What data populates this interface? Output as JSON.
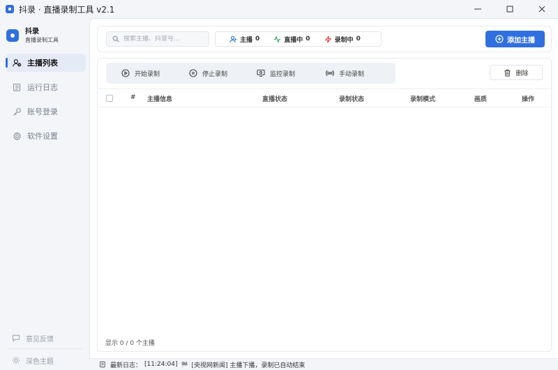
{
  "window": {
    "title": "抖录 · 直播录制工具 v2.1"
  },
  "brand": {
    "name": "抖录",
    "subtitle": "直播录制工具"
  },
  "sidebar": {
    "items": [
      {
        "label": "主播列表",
        "icon": "users-icon",
        "active": true
      },
      {
        "label": "运行日志",
        "icon": "log-icon",
        "active": false
      },
      {
        "label": "账号登录",
        "icon": "key-icon",
        "active": false
      },
      {
        "label": "软件设置",
        "icon": "gear-icon",
        "active": false
      }
    ],
    "feedback": "意见反馈",
    "theme": "深色主题"
  },
  "search": {
    "placeholder": "搜索主播、抖音号..."
  },
  "stats": {
    "streamers_label": "主播",
    "streamers_count": "0",
    "live_label": "直播中",
    "live_count": "0",
    "recording_label": "录制中",
    "recording_count": "0"
  },
  "toolbar": {
    "add_label": "添加主播",
    "start_label": "开始录制",
    "stop_label": "停止录制",
    "monitor_label": "监控录制",
    "manual_label": "手动录制",
    "delete_label": "删除"
  },
  "table": {
    "columns": [
      "#",
      "主播信息",
      "直播状态",
      "录制状态",
      "录制模式",
      "画质",
      "操作"
    ],
    "rows": []
  },
  "footer": {
    "count_text": "显示 0 / 0 个主播"
  },
  "status": {
    "label": "最新日志：",
    "time": "[11:24:04]",
    "flag": "🏁",
    "message": "[央视网新闻] 主播下播，录制已自动结束"
  },
  "colors": {
    "accent": "#2f6fe0",
    "live": "#2e9a4a",
    "recording": "#e0403a"
  }
}
